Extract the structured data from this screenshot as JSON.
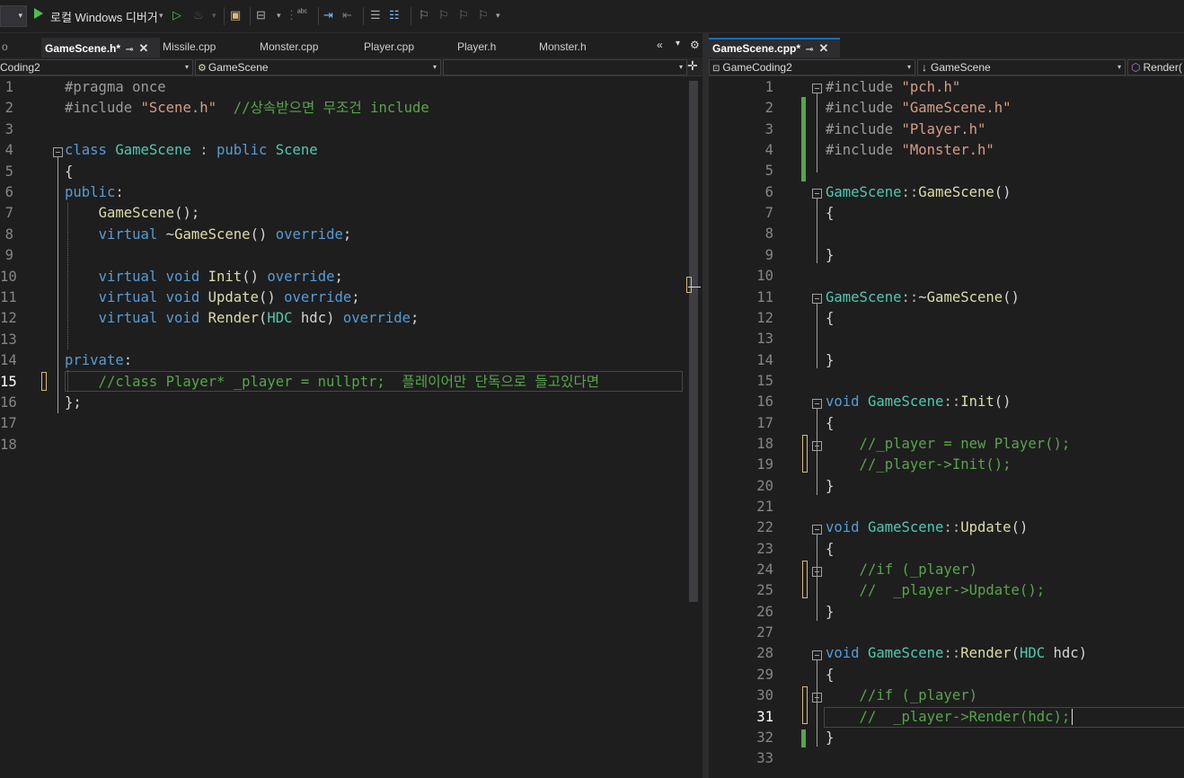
{
  "toolbar": {
    "run_label": "로컬 Windows 디버거"
  },
  "left": {
    "tabs": [
      {
        "label": "GameScene.h*",
        "active": true
      },
      {
        "label": "Missile.cpp"
      },
      {
        "label": "Monster.cpp"
      },
      {
        "label": "Player.cpp"
      },
      {
        "label": "Player.h"
      },
      {
        "label": "Monster.h"
      }
    ],
    "nav": {
      "project": "Coding2",
      "scope": "GameScene"
    },
    "current_line": "15"
  },
  "right": {
    "tabs": [
      {
        "label": "GameScene.cpp*",
        "active": true
      }
    ],
    "nav": {
      "project": "GameCoding2",
      "scope": "GameScene",
      "member": "Render("
    },
    "current_line": "31"
  },
  "colors": {
    "keyword": "#569cd6",
    "type": "#4ec9b0",
    "string": "#d69d85",
    "comment": "#57a64a",
    "preprocessor": "#9b9b9b",
    "function": "#dcdcaa",
    "accent": "#0e70c0"
  },
  "icons": [
    "play-icon",
    "start-without-debug-icon",
    "hot-reload-icon",
    "solution-icon",
    "window-icon",
    "spellcheck-icon",
    "indent-icon",
    "comment-icon",
    "bookmark-icon",
    "settings-icon"
  ],
  "left_code": [
    {
      "n": "1",
      "t": [
        {
          "c": "pp",
          "s": "#pragma once"
        }
      ]
    },
    {
      "n": "2",
      "t": [
        {
          "c": "pp",
          "s": "#include "
        },
        {
          "c": "st",
          "s": "\"Scene.h\""
        },
        {
          "c": "cm",
          "s": "  //상속받으면 무조건 include"
        }
      ]
    },
    {
      "n": "3",
      "t": []
    },
    {
      "n": "4",
      "t": [
        {
          "c": "kw",
          "s": "class "
        },
        {
          "c": "ty",
          "s": "GameScene"
        },
        {
          "c": "op",
          "s": " : "
        },
        {
          "c": "kw",
          "s": "public "
        },
        {
          "c": "ty",
          "s": "Scene"
        }
      ]
    },
    {
      "n": "5",
      "t": [
        {
          "c": "pl",
          "s": "{"
        }
      ]
    },
    {
      "n": "6",
      "t": [
        {
          "c": "kw",
          "s": "public"
        },
        {
          "c": "pl",
          "s": ":"
        }
      ]
    },
    {
      "n": "7",
      "t": [
        {
          "c": "pl",
          "s": "    "
        },
        {
          "c": "fn",
          "s": "GameScene"
        },
        {
          "c": "pl",
          "s": "();"
        }
      ]
    },
    {
      "n": "8",
      "t": [
        {
          "c": "pl",
          "s": "    "
        },
        {
          "c": "kw",
          "s": "virtual "
        },
        {
          "c": "pl",
          "s": "~"
        },
        {
          "c": "fn",
          "s": "GameScene"
        },
        {
          "c": "pl",
          "s": "() "
        },
        {
          "c": "kw",
          "s": "override"
        },
        {
          "c": "pl",
          "s": ";"
        }
      ]
    },
    {
      "n": "9",
      "t": []
    },
    {
      "n": "10",
      "t": [
        {
          "c": "pl",
          "s": "    "
        },
        {
          "c": "kw",
          "s": "virtual void "
        },
        {
          "c": "fn",
          "s": "Init"
        },
        {
          "c": "pl",
          "s": "() "
        },
        {
          "c": "kw",
          "s": "override"
        },
        {
          "c": "pl",
          "s": ";"
        }
      ]
    },
    {
      "n": "11",
      "t": [
        {
          "c": "pl",
          "s": "    "
        },
        {
          "c": "kw",
          "s": "virtual void "
        },
        {
          "c": "fn",
          "s": "Update"
        },
        {
          "c": "pl",
          "s": "() "
        },
        {
          "c": "kw",
          "s": "override"
        },
        {
          "c": "pl",
          "s": ";"
        }
      ]
    },
    {
      "n": "12",
      "t": [
        {
          "c": "pl",
          "s": "    "
        },
        {
          "c": "kw",
          "s": "virtual void "
        },
        {
          "c": "fn",
          "s": "Render"
        },
        {
          "c": "pl",
          "s": "("
        },
        {
          "c": "ty",
          "s": "HDC"
        },
        {
          "c": "pl",
          "s": " hdc) "
        },
        {
          "c": "kw",
          "s": "override"
        },
        {
          "c": "pl",
          "s": ";"
        }
      ]
    },
    {
      "n": "13",
      "t": []
    },
    {
      "n": "14",
      "t": [
        {
          "c": "kw",
          "s": "private"
        },
        {
          "c": "pl",
          "s": ":"
        }
      ]
    },
    {
      "n": "15",
      "t": [
        {
          "c": "cm",
          "s": "    //class Player* _player = nullptr;  플레이어만 단독으로 들고있다면"
        }
      ]
    },
    {
      "n": "16",
      "t": [
        {
          "c": "pl",
          "s": "};"
        }
      ]
    },
    {
      "n": "17",
      "t": []
    },
    {
      "n": "18",
      "t": []
    }
  ],
  "right_code": [
    {
      "n": "1",
      "t": [
        {
          "c": "pp",
          "s": "#include "
        },
        {
          "c": "st",
          "s": "\"pch.h\""
        }
      ]
    },
    {
      "n": "2",
      "t": [
        {
          "c": "pp",
          "s": "#include "
        },
        {
          "c": "st",
          "s": "\"GameScene.h\""
        }
      ]
    },
    {
      "n": "3",
      "t": [
        {
          "c": "pp",
          "s": "#include "
        },
        {
          "c": "st",
          "s": "\"Player.h\""
        }
      ]
    },
    {
      "n": "4",
      "t": [
        {
          "c": "pp",
          "s": "#include "
        },
        {
          "c": "st",
          "s": "\"Monster.h\""
        }
      ]
    },
    {
      "n": "5",
      "t": []
    },
    {
      "n": "6",
      "t": [
        {
          "c": "ty",
          "s": "GameScene"
        },
        {
          "c": "op",
          "s": "::"
        },
        {
          "c": "fn",
          "s": "GameScene"
        },
        {
          "c": "pl",
          "s": "()"
        }
      ]
    },
    {
      "n": "7",
      "t": [
        {
          "c": "pl",
          "s": "{"
        }
      ]
    },
    {
      "n": "8",
      "t": []
    },
    {
      "n": "9",
      "t": [
        {
          "c": "pl",
          "s": "}"
        }
      ]
    },
    {
      "n": "10",
      "t": []
    },
    {
      "n": "11",
      "t": [
        {
          "c": "ty",
          "s": "GameScene"
        },
        {
          "c": "op",
          "s": "::"
        },
        {
          "c": "pl",
          "s": "~"
        },
        {
          "c": "fn",
          "s": "GameScene"
        },
        {
          "c": "pl",
          "s": "()"
        }
      ]
    },
    {
      "n": "12",
      "t": [
        {
          "c": "pl",
          "s": "{"
        }
      ]
    },
    {
      "n": "13",
      "t": []
    },
    {
      "n": "14",
      "t": [
        {
          "c": "pl",
          "s": "}"
        }
      ]
    },
    {
      "n": "15",
      "t": []
    },
    {
      "n": "16",
      "t": [
        {
          "c": "kw",
          "s": "void "
        },
        {
          "c": "ty",
          "s": "GameScene"
        },
        {
          "c": "op",
          "s": "::"
        },
        {
          "c": "fn",
          "s": "Init"
        },
        {
          "c": "pl",
          "s": "()"
        }
      ]
    },
    {
      "n": "17",
      "t": [
        {
          "c": "pl",
          "s": "{"
        }
      ]
    },
    {
      "n": "18",
      "t": [
        {
          "c": "cm",
          "s": "    //_player = new Player();"
        }
      ]
    },
    {
      "n": "19",
      "t": [
        {
          "c": "cm",
          "s": "    //_player->Init();"
        }
      ]
    },
    {
      "n": "20",
      "t": [
        {
          "c": "pl",
          "s": "}"
        }
      ]
    },
    {
      "n": "21",
      "t": []
    },
    {
      "n": "22",
      "t": [
        {
          "c": "kw",
          "s": "void "
        },
        {
          "c": "ty",
          "s": "GameScene"
        },
        {
          "c": "op",
          "s": "::"
        },
        {
          "c": "fn",
          "s": "Update"
        },
        {
          "c": "pl",
          "s": "()"
        }
      ]
    },
    {
      "n": "23",
      "t": [
        {
          "c": "pl",
          "s": "{"
        }
      ]
    },
    {
      "n": "24",
      "t": [
        {
          "c": "cm",
          "s": "    //if (_player)"
        }
      ]
    },
    {
      "n": "25",
      "t": [
        {
          "c": "cm",
          "s": "    //  _player->Update();"
        }
      ]
    },
    {
      "n": "26",
      "t": [
        {
          "c": "pl",
          "s": "}"
        }
      ]
    },
    {
      "n": "27",
      "t": []
    },
    {
      "n": "28",
      "t": [
        {
          "c": "kw",
          "s": "void "
        },
        {
          "c": "ty",
          "s": "GameScene"
        },
        {
          "c": "op",
          "s": "::"
        },
        {
          "c": "fn",
          "s": "Render"
        },
        {
          "c": "pl",
          "s": "("
        },
        {
          "c": "ty",
          "s": "HDC"
        },
        {
          "c": "pl",
          "s": " hdc)"
        }
      ]
    },
    {
      "n": "29",
      "t": [
        {
          "c": "pl",
          "s": "{"
        }
      ]
    },
    {
      "n": "30",
      "t": [
        {
          "c": "cm",
          "s": "    //if (_player)"
        }
      ]
    },
    {
      "n": "31",
      "t": [
        {
          "c": "cm",
          "s": "    //  _player->Render(hdc);"
        }
      ]
    },
    {
      "n": "32",
      "t": [
        {
          "c": "pl",
          "s": "}"
        }
      ]
    },
    {
      "n": "33",
      "t": []
    }
  ]
}
